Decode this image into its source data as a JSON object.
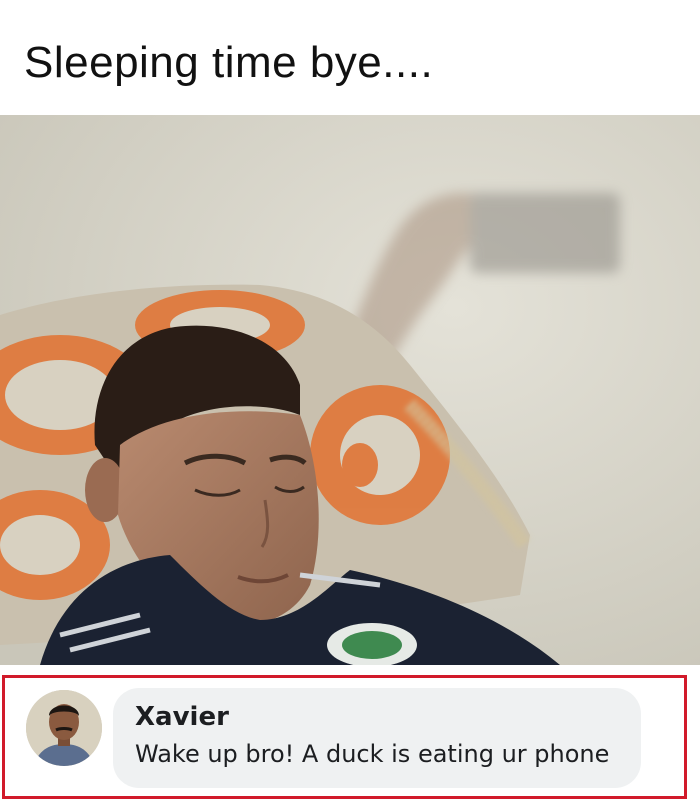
{
  "post": {
    "caption": "Sleeping time bye....",
    "photo_icon": "sleeping-boy-photo",
    "accent_colors": {
      "highlight_border": "#d11a2a",
      "bubble_bg": "#eff1f2"
    }
  },
  "comment": {
    "author": "Xavier",
    "text": "Wake up bro! A duck is eating ur phone",
    "avatar_icon": "user-avatar"
  }
}
